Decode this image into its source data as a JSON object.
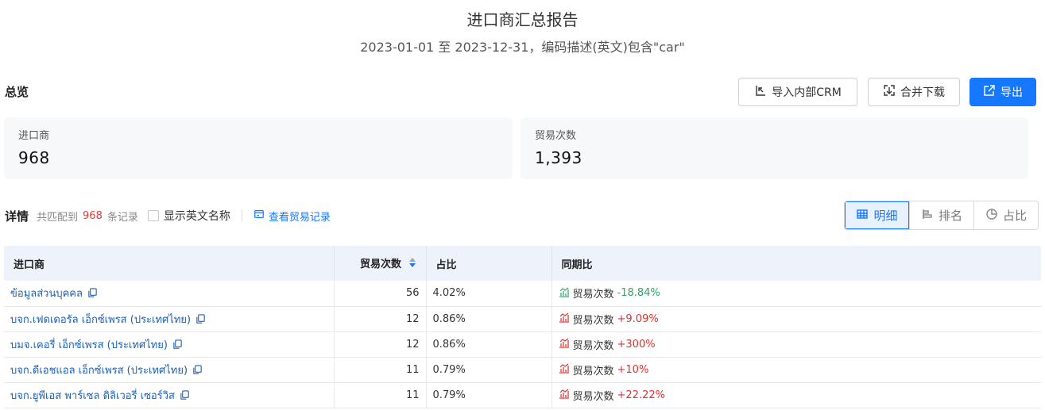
{
  "report": {
    "title": "进口商汇总报告",
    "subtitle": "2023-01-01 至 2023-12-31，编码描述(英文)包含\"car\""
  },
  "overview": {
    "label": "总览",
    "buttons": {
      "import_crm": "导入内部CRM",
      "merge_download": "合并下载",
      "export": "导出"
    },
    "cards": [
      {
        "label": "进口商",
        "value": "968"
      },
      {
        "label": "贸易次数",
        "value": "1,393"
      }
    ]
  },
  "details": {
    "title": "详情",
    "match_prefix": "共匹配到",
    "match_count": "968",
    "match_suffix": "条记录",
    "show_english_label": "显示英文名称",
    "show_english_checked": false,
    "view_records_label": "查看贸易记录",
    "view_toggle": [
      {
        "label": "明细",
        "icon": "table-icon",
        "active": true
      },
      {
        "label": "排名",
        "icon": "ranking-icon",
        "active": false
      },
      {
        "label": "占比",
        "icon": "pie-icon",
        "active": false
      }
    ]
  },
  "table": {
    "columns": {
      "importer": "进口商",
      "trade_count": "贸易次数",
      "share": "占比",
      "yoy": "同期比"
    },
    "rows": [
      {
        "importer": "ข้อมูลส่วนบุคคล",
        "trade_count": "56",
        "share": "4.02%",
        "yoy_label": "贸易次数",
        "yoy_value": "-18.84%",
        "trend": "down"
      },
      {
        "importer": "บจก.เฟดเดอรัล เอ็กซ์เพรส (ประเทศไทย)",
        "trade_count": "12",
        "share": "0.86%",
        "yoy_label": "贸易次数",
        "yoy_value": "+9.09%",
        "trend": "up"
      },
      {
        "importer": "บมจ.เคอรี่ เอ็กซ์เพรส (ประเทศไทย)",
        "trade_count": "12",
        "share": "0.86%",
        "yoy_label": "贸易次数",
        "yoy_value": "+300%",
        "trend": "up"
      },
      {
        "importer": "บจก.ดีเอชแอล เอ็กซ์เพรส (ประเทศไทย)",
        "trade_count": "11",
        "share": "0.79%",
        "yoy_label": "贸易次数",
        "yoy_value": "+10%",
        "trend": "up"
      },
      {
        "importer": "บจก.ยูพีเอส พาร์เซล ดิลิเวอรี่ เซอร์วิส",
        "trade_count": "11",
        "share": "0.79%",
        "yoy_label": "贸易次数",
        "yoy_value": "+22.22%",
        "trend": "up"
      }
    ]
  },
  "colors": {
    "accent": "#1677ff",
    "up": "#e0302c",
    "down": "#27a862",
    "highlight_count": "#e0403a"
  }
}
